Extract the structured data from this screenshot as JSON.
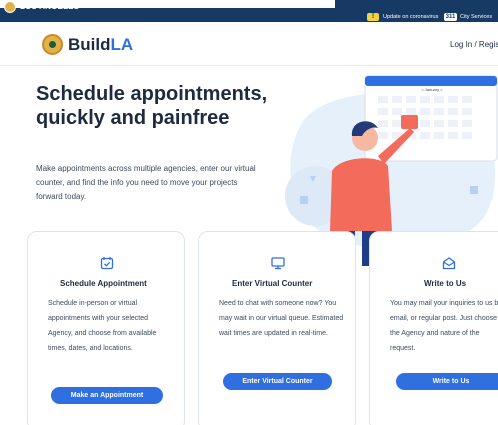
{
  "city_bar": {
    "name": "LOS ANGELES",
    "covid_badge": "!",
    "covid_text": "Update on coronavirus",
    "services_badge": "311",
    "services_text": "City Services"
  },
  "header": {
    "logo_build": "Build",
    "logo_la": "LA",
    "login_label": "Log In / Register"
  },
  "hero": {
    "title": "Schedule appointments, quickly and painfree",
    "description": "Make appointments across multiple agencies, enter our virtual counter, and find the info you need to move your projects forward today.",
    "calendar_header": "< January >"
  },
  "cards": [
    {
      "icon": "calendar-check-icon",
      "title": "Schedule Appointment",
      "body": "Schedule in-person or virtual appointments with your selected Agency, and choose from available times, dates, and locations.",
      "button": "Make an Appointment"
    },
    {
      "icon": "monitor-icon",
      "title": "Enter Virtual Counter",
      "body": "Need to chat with someone now? You may wait in our virtual queue. Estimated wait times are updated in real-time.",
      "button": "Enter Virtual Counter"
    },
    {
      "icon": "mail-icon",
      "title": "Write to Us",
      "body": "You may mail your inquiries to us by email, or regular post. Just choose the Agency and nature of the request.",
      "button": "Write to Us"
    }
  ],
  "colors": {
    "city_bar": "#173a64",
    "accent": "#2f6fe0",
    "text": "#1d2b40",
    "covid_badge": "#f5d33c"
  }
}
